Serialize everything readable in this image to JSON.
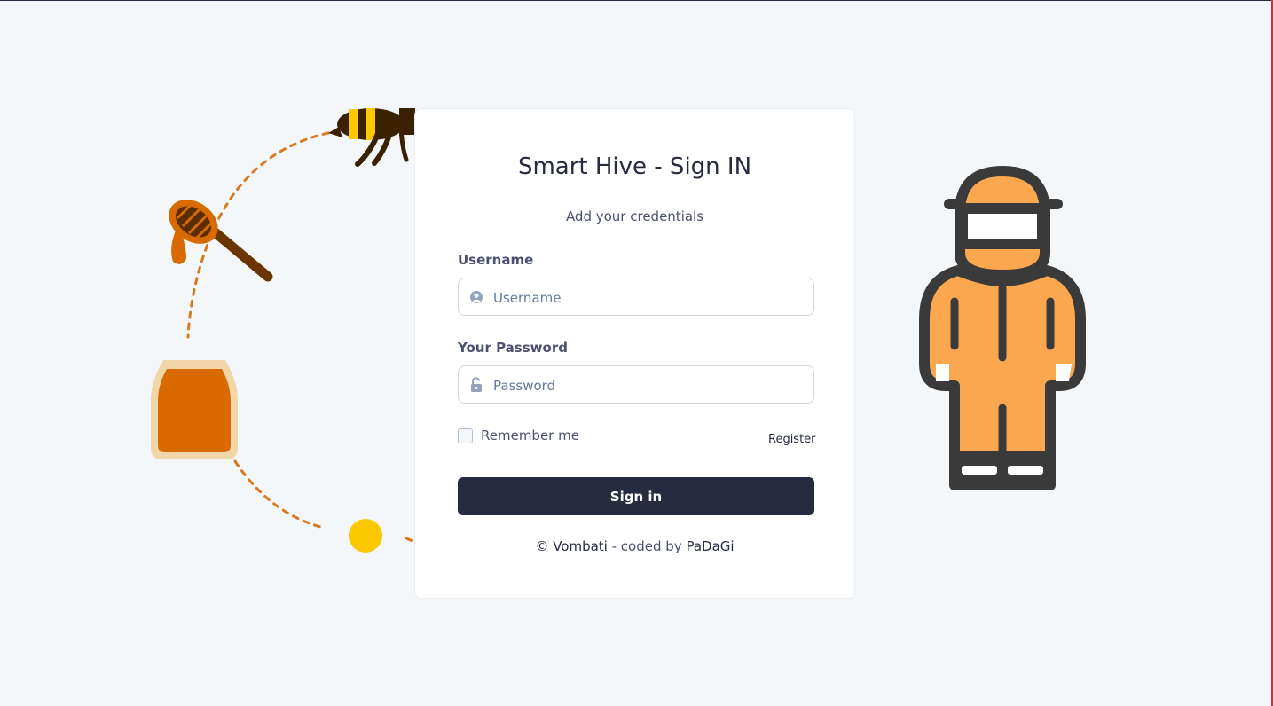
{
  "colors": {
    "accent": "#262b40",
    "honey": "#d96a00",
    "jar_rim": "#f0d6a8",
    "bee_yellow": "#fcc800",
    "suit_orange": "#fba74f",
    "suit_outline": "#3a3a3a"
  },
  "illustrations": {
    "left": [
      "bee-icon",
      "honey-dipper-icon",
      "honey-jar-icon",
      "sun-dot-icon"
    ],
    "right": "beekeeper-icon"
  },
  "login": {
    "title": "Smart Hive - Sign IN",
    "subtitle": "Add your credentials",
    "username": {
      "label": "Username",
      "placeholder": "Username",
      "value": ""
    },
    "password": {
      "label": "Your Password",
      "placeholder": "Password",
      "value": ""
    },
    "remember_label": "Remember me",
    "remember_checked": false,
    "register_label": "Register",
    "submit_label": "Sign in",
    "footer": {
      "prefix": "© Vombati",
      "middle": " - coded by ",
      "author": "PaDaGi"
    }
  }
}
